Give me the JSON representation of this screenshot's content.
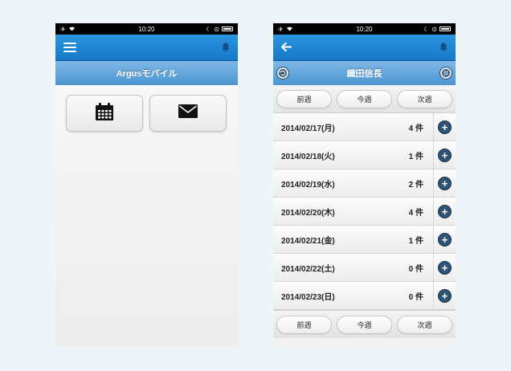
{
  "status_bar": {
    "time": "10:20"
  },
  "left_screen": {
    "app_title": "Argusモバイル",
    "icons": {
      "menu": "hamburger-icon",
      "notifications": "bell-icon",
      "calendar": "calendar-icon",
      "mail": "mail-icon"
    }
  },
  "right_screen": {
    "person_name": "織田信長",
    "week_buttons": {
      "prev": "前週",
      "current": "今週",
      "next": "次週"
    },
    "days": [
      {
        "date": "2014/02/17(月)",
        "count": "4 件"
      },
      {
        "date": "2014/02/18(火)",
        "count": "1 件"
      },
      {
        "date": "2014/02/19(水)",
        "count": "2 件"
      },
      {
        "date": "2014/02/20(木)",
        "count": "4 件"
      },
      {
        "date": "2014/02/21(金)",
        "count": "1 件"
      },
      {
        "date": "2014/02/22(土)",
        "count": "0 件"
      },
      {
        "date": "2014/02/23(日)",
        "count": "0 件"
      }
    ],
    "add_symbol": "+",
    "icons": {
      "back": "arrow-left-icon",
      "notifications": "bell-icon",
      "undo": "undo-icon",
      "grid": "grid-icon",
      "add": "plus-circle-icon"
    }
  },
  "colors": {
    "header_blue": "#1e86d4",
    "title_blue": "#5fa3da",
    "add_button": "#2e5475",
    "background": "#eef5f9"
  }
}
